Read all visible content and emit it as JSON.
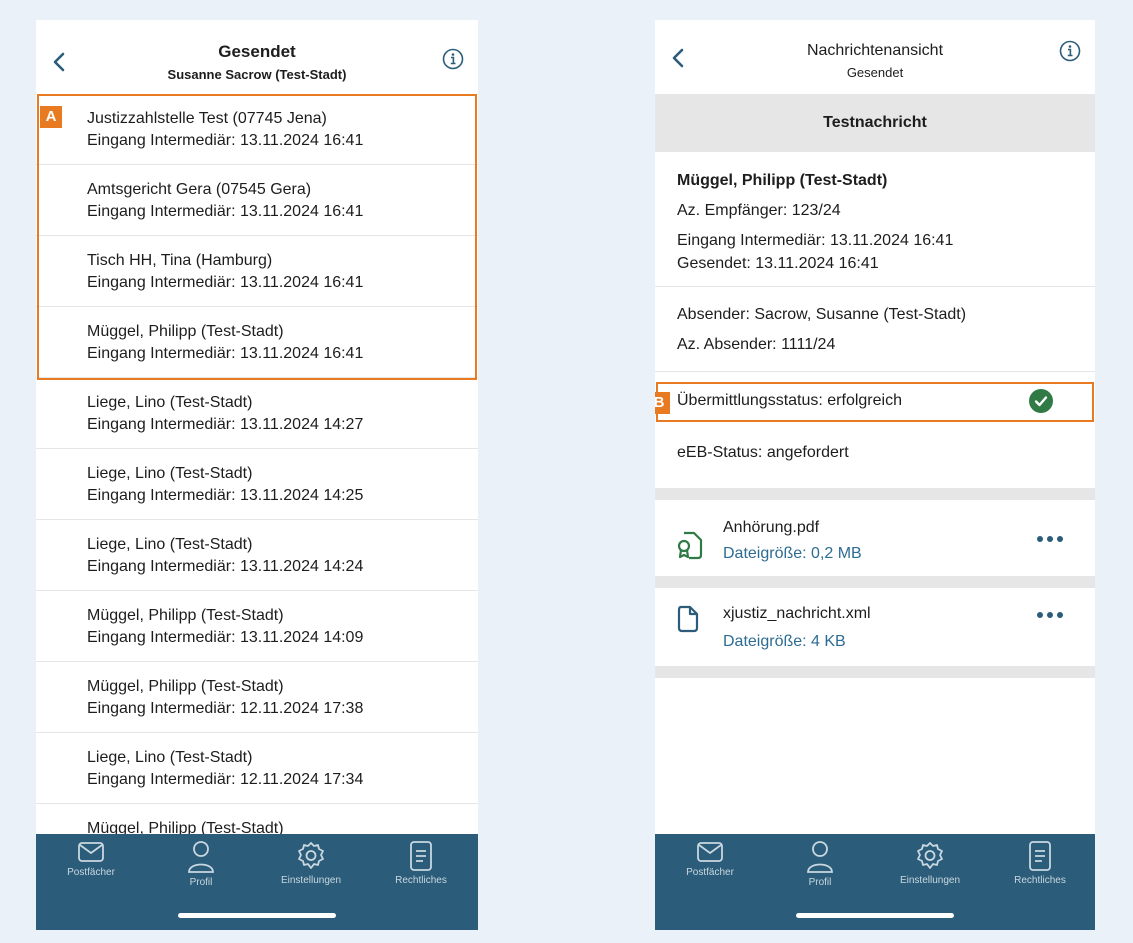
{
  "left": {
    "header": {
      "title": "Gesendet",
      "subtitle": "Susanne Sacrow (Test-Stadt)"
    },
    "callout": "A",
    "messages": [
      {
        "name": "Justizzahlstelle Test (07745 Jena)",
        "date": "Eingang Intermediär: 13.11.2024 16:41"
      },
      {
        "name": "Amtsgericht Gera (07545 Gera)",
        "date": "Eingang Intermediär: 13.11.2024 16:41"
      },
      {
        "name": "Tisch HH, Tina (Hamburg)",
        "date": "Eingang Intermediär: 13.11.2024 16:41"
      },
      {
        "name": "Müggel, Philipp (Test-Stadt)",
        "date": "Eingang Intermediär: 13.11.2024 16:41"
      },
      {
        "name": "Liege, Lino (Test-Stadt)",
        "date": "Eingang Intermediär: 13.11.2024 14:27"
      },
      {
        "name": "Liege, Lino (Test-Stadt)",
        "date": "Eingang Intermediär: 13.11.2024 14:25"
      },
      {
        "name": "Liege, Lino (Test-Stadt)",
        "date": "Eingang Intermediär: 13.11.2024 14:24"
      },
      {
        "name": "Müggel, Philipp (Test-Stadt)",
        "date": "Eingang Intermediär: 13.11.2024 14:09"
      },
      {
        "name": "Müggel, Philipp (Test-Stadt)",
        "date": "Eingang Intermediär: 12.11.2024 17:38"
      },
      {
        "name": "Liege, Lino (Test-Stadt)",
        "date": "Eingang Intermediär: 12.11.2024 17:34"
      },
      {
        "name": "Müggel, Philipp (Test-Stadt)",
        "date": ""
      }
    ]
  },
  "right": {
    "header": {
      "title": "Nachrichtenansicht",
      "subtitle": "Gesendet"
    },
    "subject": "Testnachricht",
    "recipient": "Müggel, Philipp (Test-Stadt)",
    "az_empfaenger": "Az. Empfänger: 123/24",
    "eingang": "Eingang Intermediär: 13.11.2024 16:41",
    "gesendet": "Gesendet: 13.11.2024 16:41",
    "absender": "Absender: Sacrow, Susanne (Test-Stadt)",
    "az_absender": "Az. Absender: 1111/24",
    "callout": "B",
    "status": "Übermittlungsstatus: erfolgreich",
    "status_color": "#2f7a45",
    "eeb_status": "eEB-Status: angefordert",
    "files": [
      {
        "name": "Anhörung.pdf",
        "size": "Dateigröße: 0,2 MB",
        "icon": "signed-document-icon"
      },
      {
        "name": "xjustiz_nachricht.xml",
        "size": "Dateigröße: 4 KB",
        "icon": "document-icon"
      }
    ]
  },
  "tabbar": {
    "tabs": [
      {
        "label": "Postfächer",
        "icon": "mail-icon"
      },
      {
        "label": "Profil",
        "icon": "person-icon"
      },
      {
        "label": "Einstellungen",
        "icon": "gear-icon"
      },
      {
        "label": "Rechtliches",
        "icon": "document-list-icon"
      }
    ]
  },
  "colors": {
    "tabbar": "#2b5c79",
    "highlight": "#e87a22",
    "link": "#2d6c93"
  }
}
